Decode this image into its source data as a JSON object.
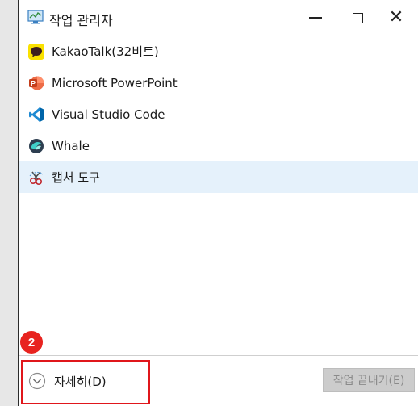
{
  "window": {
    "title": "작업 관리자",
    "minimize_glyph": "",
    "maximize_glyph": "",
    "close_glyph": "✕"
  },
  "apps": [
    {
      "label": "KakaoTalk(32비트)",
      "icon": "kakaotalk-icon",
      "selected": false
    },
    {
      "label": "Microsoft PowerPoint",
      "icon": "powerpoint-icon",
      "selected": false
    },
    {
      "label": "Visual Studio Code",
      "icon": "vscode-icon",
      "selected": false
    },
    {
      "label": "Whale",
      "icon": "whale-icon",
      "selected": false
    },
    {
      "label": "캡처 도구",
      "icon": "snipping-tool-icon",
      "selected": true
    }
  ],
  "footer": {
    "details_label": "자세히(D)",
    "end_task_label": "작업 끝내기(E)",
    "end_task_enabled": false
  },
  "annotation": {
    "step_number": "2",
    "color": "#e0161b"
  },
  "colors": {
    "selected_row": "#e5f1fb",
    "kakao_yellow": "#fae100",
    "powerpoint_orange": "#d24726",
    "vscode_blue": "#1f8ad2"
  }
}
